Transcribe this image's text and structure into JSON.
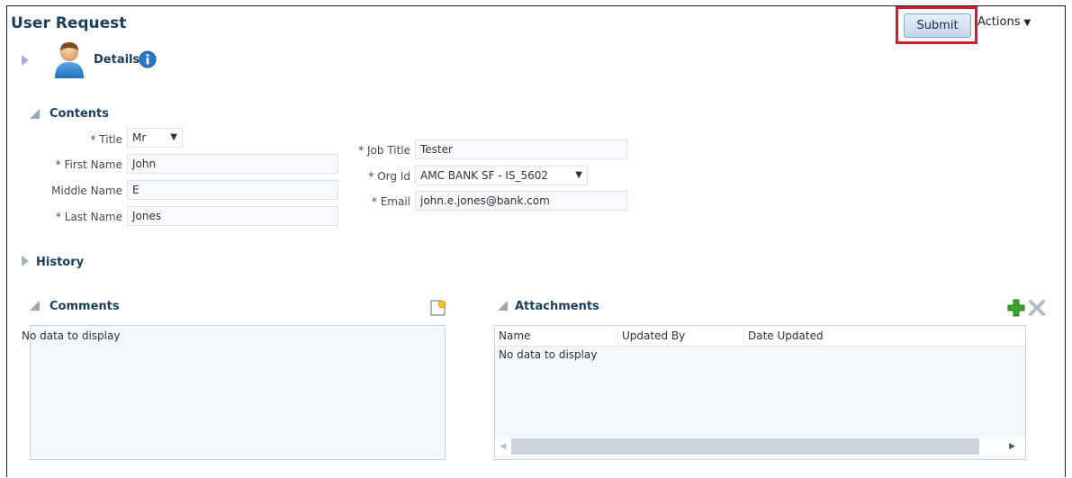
{
  "page": {
    "title": "User Request"
  },
  "toolbar": {
    "submit_label": "Submit",
    "actions_label": "Actions",
    "actions_caret": "▼"
  },
  "sections": {
    "details": "Details",
    "contents": "Contents",
    "history": "History",
    "comments": "Comments",
    "attachments": "Attachments"
  },
  "form": {
    "required_mark": "*",
    "title": {
      "label": "Title",
      "value": "Mr"
    },
    "first_name": {
      "label": "First Name",
      "value": "John"
    },
    "middle_name": {
      "label": "Middle Name",
      "value": "E"
    },
    "last_name": {
      "label": "Last Name",
      "value": "Jones"
    },
    "job_title": {
      "label": "Job Title",
      "value": "Tester"
    },
    "org_id": {
      "label": "Org Id",
      "value": "AMC BANK SF - IS_5602"
    },
    "email": {
      "label": "Email",
      "value": "john.e.jones@bank.com"
    }
  },
  "comments": {
    "empty_text": "No data to display"
  },
  "attachments": {
    "columns": [
      "Name",
      "Updated By",
      "Date Updated"
    ],
    "empty_text": "No data to display"
  },
  "icons": {
    "select_caret": "▼",
    "scroll_left": "◀",
    "scroll_right": "▶",
    "add": "+",
    "delete": "✕"
  },
  "colors": {
    "heading": "#1a3f5f",
    "highlight": "#d7192c",
    "add_icon": "#3aa52b"
  }
}
